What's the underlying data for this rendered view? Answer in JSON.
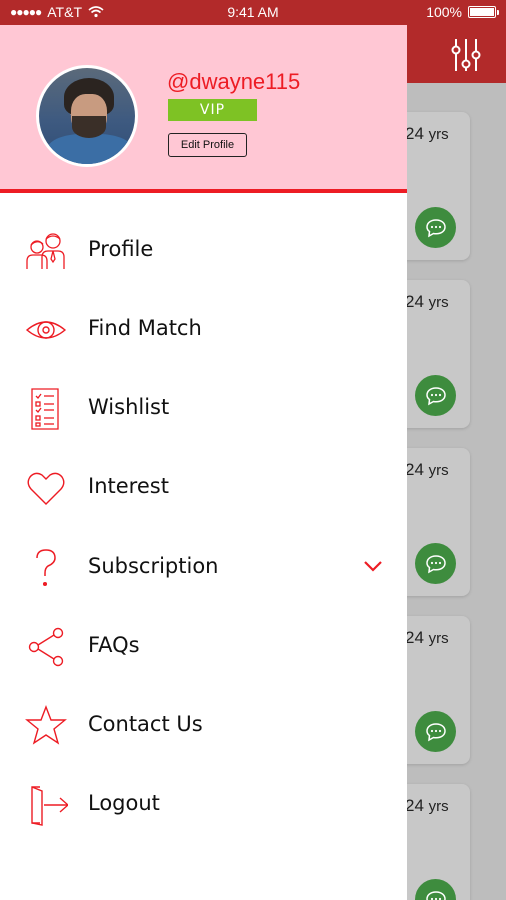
{
  "status": {
    "carrier": "AT&T",
    "time": "9:41 AM",
    "battery": "100%"
  },
  "background": {
    "cards": [
      {
        "age": "24",
        "unit": "yrs"
      },
      {
        "age": "24",
        "unit": "yrs"
      },
      {
        "age": "24",
        "unit": "yrs"
      },
      {
        "age": "24",
        "unit": "yrs"
      },
      {
        "age": "24",
        "unit": "yrs"
      }
    ]
  },
  "drawer": {
    "username": "@dwayne115",
    "badge": "VIP",
    "edit_label": "Edit Profile",
    "menu": [
      {
        "label": "Profile",
        "icon": "people-icon"
      },
      {
        "label": "Find Match",
        "icon": "eye-icon"
      },
      {
        "label": "Wishlist",
        "icon": "checklist-icon"
      },
      {
        "label": "Interest",
        "icon": "heart-icon"
      },
      {
        "label": "Subscription",
        "icon": "question-icon"
      },
      {
        "label": "FAQs",
        "icon": "share-icon"
      },
      {
        "label": "Contact Us",
        "icon": "star-icon"
      },
      {
        "label": "Logout",
        "icon": "logout-icon"
      }
    ]
  },
  "colors": {
    "accent": "#ed1c24",
    "header": "#b22a2a",
    "profile_bg": "#ffc7d4",
    "vip": "#7ec224",
    "chat": "#3e8c3e"
  }
}
